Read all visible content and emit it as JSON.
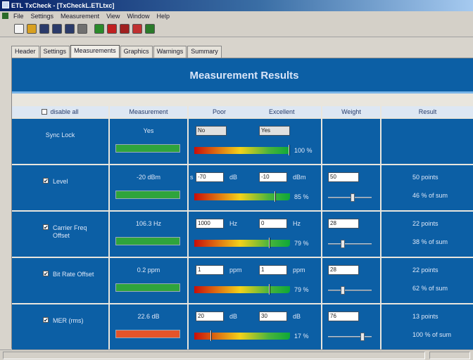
{
  "window": {
    "title": "ETL TxCheck - [TxCheckL.ETLtxc]"
  },
  "menu": [
    "File",
    "Settings",
    "Measurement",
    "View",
    "Window",
    "Help"
  ],
  "toolbar": {
    "icons": [
      "new-icon",
      "open-icon",
      "save-icon",
      "save-as-icon",
      "save-all-icon",
      "print-icon",
      "run-icon",
      "stop-icon",
      "swap-icon",
      "report-icon",
      "chart-icon"
    ],
    "colors": [
      "#f4f4f4",
      "#d8a020",
      "#2a3a6a",
      "#2a3a6a",
      "#2a3a6a",
      "#707070",
      "#2a8a2a",
      "#c02020",
      "#a02020",
      "#c03030",
      "#2a7a2a"
    ]
  },
  "tabs": [
    "Header",
    "Settings",
    "Measurements",
    "Graphics",
    "Warnings",
    "Summary"
  ],
  "active_tab": 2,
  "header": {
    "title": "Measurement Results"
  },
  "columns": {
    "label": "disable all",
    "measurement": "Measurement",
    "poor": "Poor",
    "excellent": "Excellent",
    "weight": "Weight",
    "result": "Result"
  },
  "colors": {
    "panel_blue": "#0c5fa5",
    "header_cell": "#dde7f3",
    "ok": "#2fa43c",
    "bad": "#e5542a"
  },
  "rows": [
    {
      "label": "Sync Lock",
      "measurement": "Yes",
      "status": "green",
      "poor": "No",
      "excellent": "Yes",
      "percent": "100 %",
      "level": 1.0
    },
    {
      "label": "Level",
      "checked": "✔",
      "measurement": "-20 dBm",
      "status": "green",
      "prefix": "s",
      "poor": "-70",
      "poor_unit": "dB",
      "excellent": "-10",
      "excellent_unit": "dBm",
      "weight": "50",
      "weight_level": 0.58,
      "percent": "85 %",
      "level": 0.85,
      "points": "50 points",
      "share": "46 % of sum"
    },
    {
      "label": "Carrier Freq",
      "label2": "Offset",
      "checked": "✔",
      "measurement": "106.3 Hz",
      "status": "green",
      "poor": "1000",
      "poor_unit": "Hz",
      "excellent": "0",
      "excellent_unit": "Hz",
      "weight": "28",
      "weight_level": 0.32,
      "percent": "79 %",
      "level": 0.79,
      "points": "22 points",
      "share": "38 % of sum"
    },
    {
      "label": "Bit Rate Offset",
      "checked": "✔",
      "measurement": "0.2 ppm",
      "status": "green",
      "poor": "1",
      "poor_unit": "ppm",
      "excellent": "1",
      "excellent_unit": "ppm",
      "weight": "28",
      "weight_level": 0.32,
      "percent": "79 %",
      "level": 0.79,
      "points": "22 points",
      "share": "62 % of sum"
    },
    {
      "label": "MER (rms)",
      "checked": "✔",
      "measurement": "22.6 dB",
      "status": "red",
      "poor": "20",
      "poor_unit": "dB",
      "excellent": "30",
      "excellent_unit": "dB",
      "weight": "76",
      "weight_level": 0.82,
      "percent": "17 %",
      "level": 0.17,
      "points": "13 points",
      "share": "100 % of sum"
    }
  ]
}
